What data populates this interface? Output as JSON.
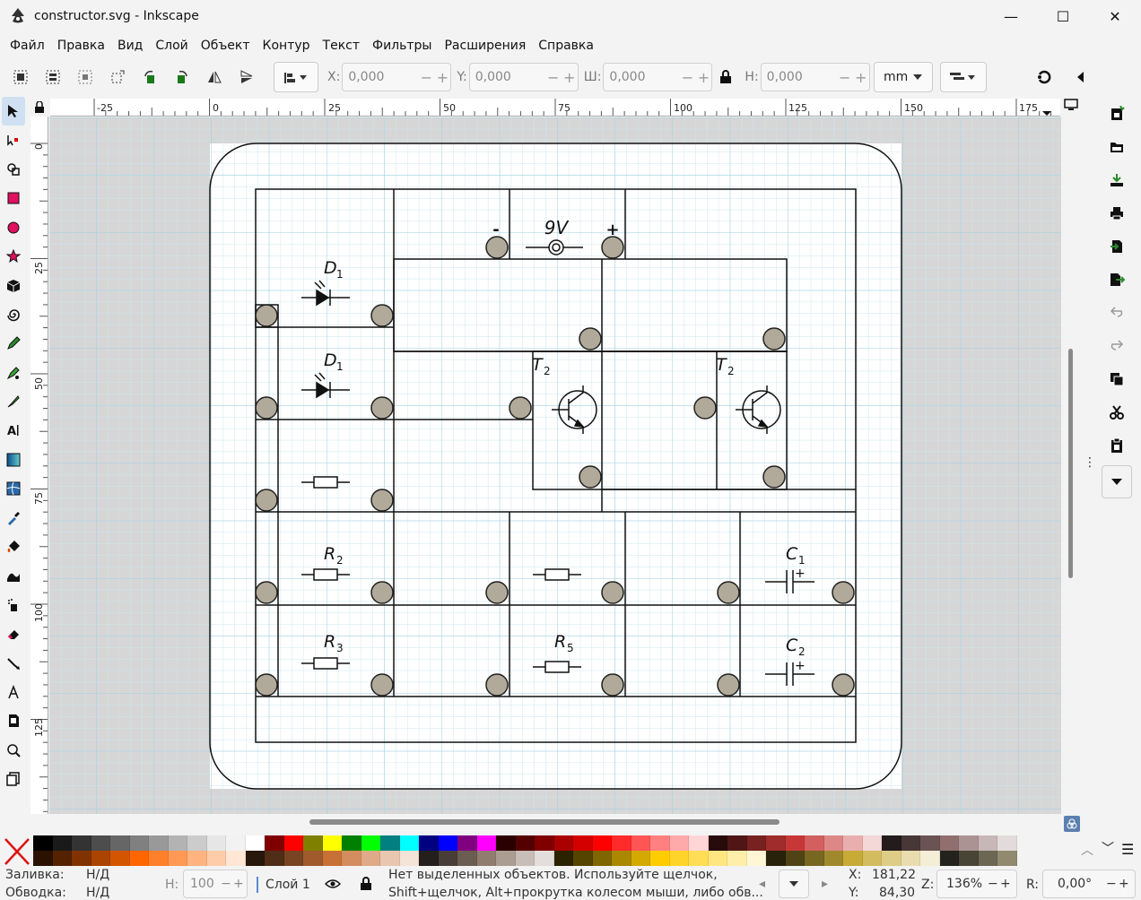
{
  "window": {
    "title": "constructor.svg - Inkscape",
    "minimize": "—",
    "maximize": "☐",
    "close": "✕"
  },
  "menu": [
    "Файл",
    "Правка",
    "Вид",
    "Слой",
    "Объект",
    "Контур",
    "Текст",
    "Фильтры",
    "Расширения",
    "Справка"
  ],
  "toolbar": {
    "x_label": "X:",
    "x_value": "0,000",
    "y_label": "Y:",
    "y_value": "0,000",
    "w_label": "Ш:",
    "w_value": "0,000",
    "h_label": "Н:",
    "h_value": "0,000",
    "unit": "mm",
    "minus": "−",
    "plus": "+"
  },
  "ruler": {
    "h_ticks": [
      "-25",
      "0",
      "25",
      "50",
      "75",
      "100",
      "125",
      "150",
      "175"
    ],
    "v_ticks": [
      "0",
      "25",
      "50",
      "75",
      "100",
      "125"
    ]
  },
  "drawing": {
    "battery_voltage": "9V",
    "battery_minus": "-",
    "battery_plus": "+",
    "labels": {
      "d1_top": "D",
      "d1_top_sub": "1",
      "d1_bot": "D",
      "d1_bot_sub": "1",
      "t2_left": "T",
      "t2_left_sub": "2",
      "t2_right": "T",
      "t2_right_sub": "2",
      "r2": "R",
      "r2_sub": "2",
      "r3": "R",
      "r3_sub": "3",
      "r5": "R",
      "r5_sub": "5",
      "c1": "C",
      "c1_sub": "1",
      "c2": "C",
      "c2_sub": "2",
      "cap_plus": "+"
    }
  },
  "palette": {
    "colors": [
      "#000000",
      "#1a1a1a",
      "#333333",
      "#4d4d4d",
      "#666666",
      "#808080",
      "#999999",
      "#b3b3b3",
      "#cccccc",
      "#e6e6e6",
      "#f2f2f2",
      "#ffffff",
      "#800000",
      "#ff0000",
      "#808000",
      "#ffff00",
      "#008000",
      "#00ff00",
      "#008080",
      "#00ffff",
      "#000080",
      "#0000ff",
      "#800080",
      "#ff00ff",
      "#2b0000",
      "#550000",
      "#800000",
      "#aa0000",
      "#d40000",
      "#ff0000",
      "#ff2a2a",
      "#ff5555",
      "#ff8080",
      "#ffaaaa",
      "#ffd5d5",
      "#280b0b",
      "#501616",
      "#782121",
      "#a02c2c",
      "#c83737",
      "#d35f5f",
      "#de8787",
      "#e9afaf",
      "#f4d7d7",
      "#241c1c",
      "#483737",
      "#6c5353",
      "#916f6f",
      "#ac9393",
      "#c8b7b7",
      "#e3dbdb"
    ],
    "colors2": [
      "#2b1100",
      "#552200",
      "#803300",
      "#aa4400",
      "#d45500",
      "#ff6600",
      "#ff7f2a",
      "#ff9955",
      "#ffb380",
      "#ffccaa",
      "#ffe6d5",
      "#28170b",
      "#502d16",
      "#784421",
      "#a05a2c",
      "#c87137",
      "#d38d5f",
      "#deaa87",
      "#e9c6af",
      "#f4e3d7",
      "#241f1c",
      "#483e37",
      "#6c5d53",
      "#917c6f",
      "#ac9d93",
      "#c8beb7",
      "#e3dedb",
      "#2b2200",
      "#554400",
      "#806600",
      "#aa8800",
      "#d4aa00",
      "#ffcc00",
      "#ffd42a",
      "#ffdd55",
      "#ffe680",
      "#ffeeaa",
      "#fff6d5",
      "#28220b",
      "#504416",
      "#786721",
      "#a0892c",
      "#c8ab37",
      "#d3bc5f",
      "#decd87",
      "#e9ddaf",
      "#f4eed7",
      "#24221c",
      "#484537",
      "#6c6753",
      "#918a6f"
    ]
  },
  "status": {
    "fill_label": "Заливка:",
    "fill_value": "Н/Д",
    "stroke_label": "Обводка:",
    "stroke_value": "Н/Д",
    "opacity_label": "Н:",
    "opacity_value": "100",
    "layer": "Слой 1",
    "message_line1": "Нет выделенных объектов. Используйте щелчок,",
    "message_line2": "Shift+щелчок, Alt+прокрутка колесом мыши, либо обв...",
    "x_label": "X:",
    "x_value": "181,22",
    "y_label": "Y:",
    "y_value": "84,30",
    "zoom_label": "Z:",
    "zoom_value": "136%",
    "rotate_label": "R:",
    "rotate_value": "0,00°"
  }
}
